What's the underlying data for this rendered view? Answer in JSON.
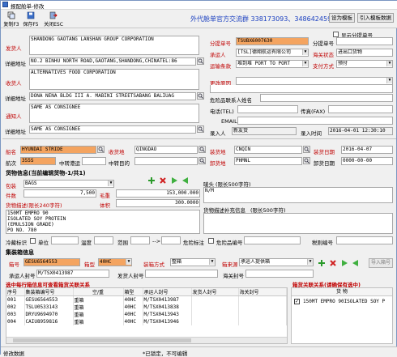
{
  "window": {
    "title": "报配舱单-修改"
  },
  "toolbar": {
    "buttons": [
      {
        "label": "复制F3"
      },
      {
        "label": "保存F5"
      },
      {
        "label": "关闭ESC"
      }
    ],
    "company": "外代舱单官方交流群 338173093、348642459",
    "set_template": "设为模板",
    "import_template": "引入模板数据",
    "show_sub_bl": "显示分提单号"
  },
  "parties": {
    "shipper_label": "发货人",
    "shipper_text": "SHANDONG GAOTANG LANSHAN GROUP CORPORATION",
    "detail_label": "详细地址",
    "shipper_addr": "NO.2 BINHU NORTH ROAD,GAOTANG,SHANDONG,CHINATEL:86",
    "consignee_label": "收货人",
    "consignee_text": "ALTERNATIVES FOOD CORPORATION",
    "consignee_addr": "DONA NENA BLDG III A. MABINI STREETSABANG BALIUAG",
    "notify_label": "通知人",
    "notify_text": "SAME AS CONSIGNEE",
    "notify_addr": "SAME AS CONSIGNEE"
  },
  "bl": {
    "main_bl_label": "分提单号",
    "main_bl": "TSUBX6007630",
    "sub_bl_label": "分提单号",
    "carrier_label": "承运人",
    "carrier": "[TSL]德翔航运有限公司",
    "customs_status_label": "海关状态",
    "customs_status": "进出口货物",
    "terms_label": "运输条款",
    "terms": "堆到堆 PORT TO PORT",
    "pay_label": "支付方式",
    "pay": "预付",
    "change_reason_label": "更改原因",
    "danger_contact_label": "危险品联系人姓名",
    "tel_label": "电话(TEL)",
    "fax_label": "传真(FAX)",
    "email_label": "EMAIL",
    "entry_label": "录入人",
    "entry": "新友货",
    "entry_time_label": "录入时间",
    "entry_time": "2016-04-01 12:30:10"
  },
  "voyage": {
    "ship_label": "船名",
    "ship": "HYUNDAI STRIDE",
    "load_port_label": "收货地",
    "load_port": "QINGDAO",
    "loading_label": "装货地",
    "loading": "CNQIN",
    "load_date_label": "装货日期",
    "load_date": "2016-04-07",
    "voy_label": "航次",
    "voy": "355S",
    "transship_label": "中转港运",
    "transit_label": "中转目的",
    "unload_label": "卸货地",
    "unload": "PHMNL",
    "unload_date_label": "卸货日期",
    "unload_date": "0000-00-00"
  },
  "cargo": {
    "section_title": "货物信息(当前编辑货物-1/共1)",
    "pkg_label": "包装",
    "pkg": "BAGS",
    "pieces_label": "件数",
    "pieces": "7,500",
    "gross_label": "毛重",
    "gross": "153,000.000",
    "desc_label": "货物描述",
    "desc_hint": "(限长240字符)",
    "volume_label": "体积",
    "volume": "300.0000",
    "desc_text": "150MT EMPRO 90\nISOLATED SOY PROTEIN\n(EMULSION GRADE)\nPO NO. 780",
    "marks_label": "唛头",
    "marks_hint": "(限长500字符)",
    "marks": "N/M",
    "desc_extra_label": "货物描述补充信息",
    "desc_extra_hint": "(限长500字符)",
    "cold_label": "冷藏标识",
    "unit_label": "单位",
    "temp_label": "温度",
    "range_label": "范围",
    "arrow": "-->",
    "danger_class_label": "危险标注",
    "danger_no_label": "危险品编号",
    "tax_label": "税则编号"
  },
  "container": {
    "section_title": "集装箱信息",
    "box_label": "箱号",
    "box": "GESU6564553",
    "type_label": "箱型",
    "type": "40HC",
    "loadmode_label": "装箱方式",
    "loadmode": "整箱",
    "source_label": "箱来源",
    "source": "承运人提供箱",
    "seal_label": "承运人封号",
    "seal": "M/TSX0413987",
    "ship_seal_label": "发货人封号",
    "customs_seal_label": "海关封号",
    "import_label": "导入箱号",
    "table_title": "选中每行箱信息可查看箱货关联关系",
    "headers": [
      "序号",
      "集装箱编号号",
      "空/重",
      "箱型",
      "承运人封号",
      "发货人封号",
      "海关封号"
    ],
    "rows": [
      [
        "001",
        "GESU6564553",
        "重箱",
        "40HC",
        "M/TSX0413987",
        "",
        ""
      ],
      [
        "002",
        "TSLU0533143",
        "重箱",
        "40HC",
        "M/TSX0413838",
        "",
        ""
      ],
      [
        "003",
        "DRYU9694970",
        "重箱",
        "40HC",
        "M/TSX0413943",
        "",
        ""
      ],
      [
        "004",
        "CAIU8959816",
        "重箱",
        "40HC",
        "M/TSX0413946",
        "",
        ""
      ]
    ],
    "rel_title": "箱货关联关系(请确保有选中)",
    "rel_header": "货 物",
    "rel_row": "150MT EMPRO 90ISOLATED SOY P"
  },
  "status": {
    "left": "修改数据",
    "mid": "*已锁定，不可编辑"
  }
}
